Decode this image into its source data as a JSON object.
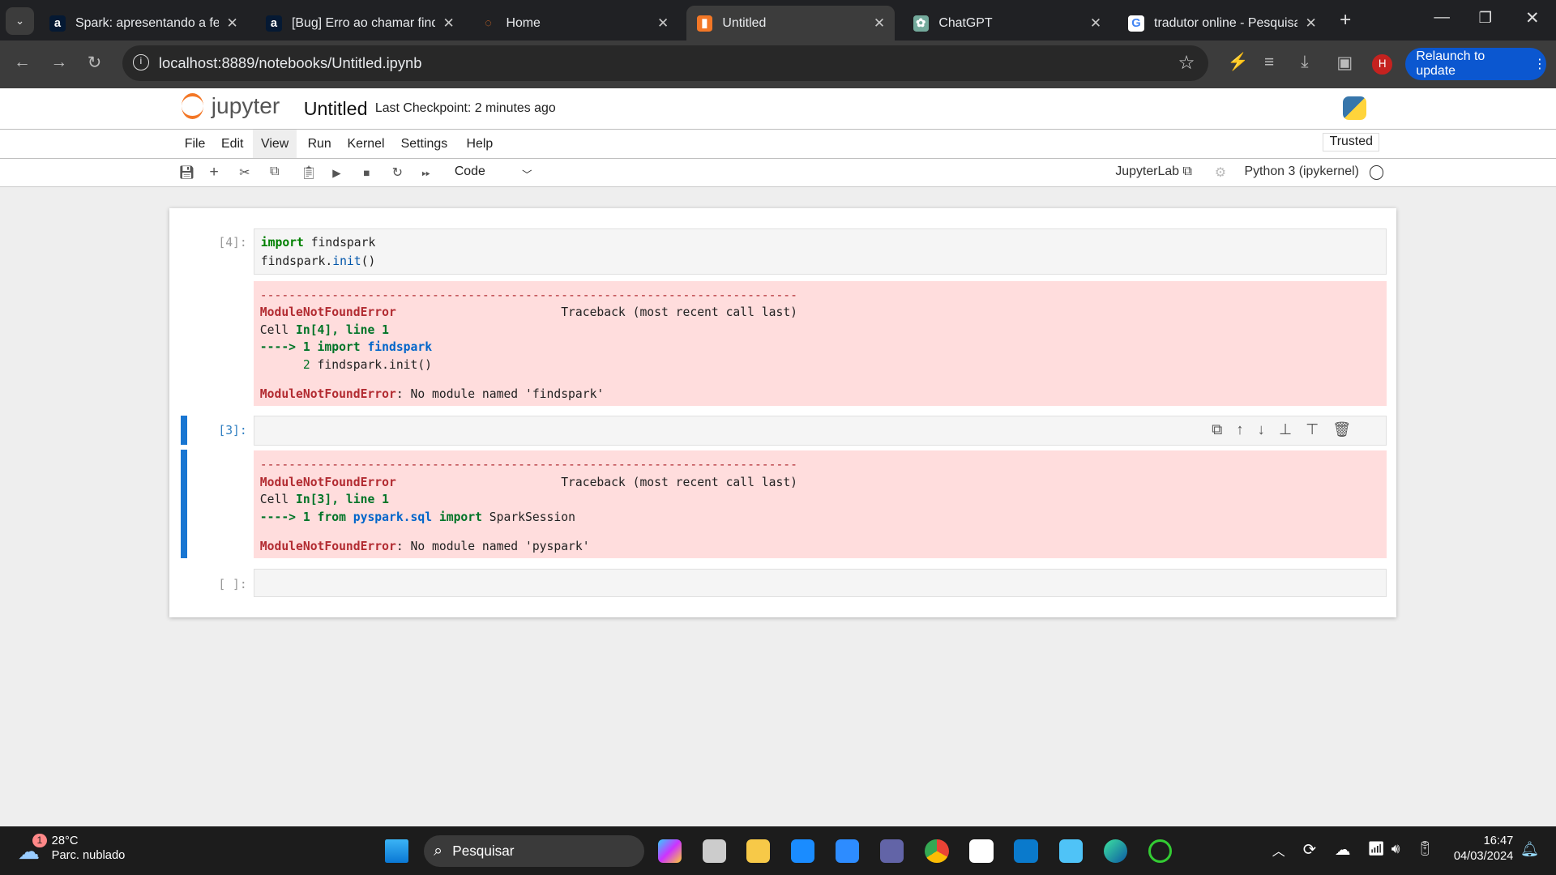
{
  "browser": {
    "tabs": [
      {
        "title": "Spark: apresentando a ferra",
        "icon": "alura-icon",
        "color": "#051933",
        "glyph": "a"
      },
      {
        "title": "[Bug] Erro ao chamar findsp",
        "icon": "alura-icon",
        "color": "#051933",
        "glyph": "a"
      },
      {
        "title": "Home",
        "icon": "jupyter-icon",
        "color": "transparent",
        "glyph": "◌"
      },
      {
        "title": "Untitled",
        "icon": "jupyter-notebook-icon",
        "color": "#f37726",
        "glyph": "▮",
        "active": true
      },
      {
        "title": "ChatGPT",
        "icon": "chatgpt-icon",
        "color": "#74aa9c",
        "glyph": "✿"
      },
      {
        "title": "tradutor online - Pesquisa",
        "icon": "google-icon",
        "color": "#fff",
        "glyph": "G"
      }
    ],
    "url": "localhost:8889/notebooks/Untitled.ipynb",
    "relaunch_label": "Relaunch to update",
    "profile_initial": "H"
  },
  "jupyter": {
    "logo_text": "jupyter",
    "notebook_title": "Untitled",
    "checkpoint": "Last Checkpoint: 2 minutes ago",
    "trusted": "Trusted",
    "menu": [
      "File",
      "Edit",
      "View",
      "Run",
      "Kernel",
      "Settings",
      "Help"
    ],
    "cell_type": "Code",
    "jupyterlab_link": "JupyterLab",
    "kernel": "Python 3 (ipykernel)"
  },
  "cells": [
    {
      "prompt": "[4]:",
      "code": [
        [
          [
            "import",
            "kw"
          ],
          [
            " findspark",
            ""
          ]
        ],
        [
          [
            "findspark.",
            ""
          ],
          [
            "init",
            "fn"
          ],
          [
            "()",
            ""
          ]
        ]
      ],
      "output": [
        [
          [
            "---------------------------------------------------------------------------",
            "c-red"
          ]
        ],
        [
          [
            "ModuleNotFoundError",
            "c-redb"
          ],
          [
            "                       Traceback (most recent call last)",
            ""
          ]
        ],
        [
          [
            "Cell ",
            ""
          ],
          [
            "In[4], line 1",
            "c-greenb"
          ]
        ],
        [
          [
            "----> 1 ",
            "c-greenb"
          ],
          [
            "import ",
            "c-greenb"
          ],
          [
            "findspark",
            "c-blueb"
          ]
        ],
        [
          [
            "      2 ",
            "c-green"
          ],
          [
            "findspark.init()",
            ""
          ]
        ],
        [
          [
            "",
            ""
          ]
        ],
        [
          [
            "ModuleNotFoundError",
            "c-redb"
          ],
          [
            ": No module named 'findspark'",
            ""
          ]
        ]
      ]
    },
    {
      "prompt": "[3]:",
      "code": [
        [
          [
            "from",
            "kw"
          ],
          [
            " pyspark.sql ",
            ""
          ],
          [
            "import",
            "kw"
          ],
          [
            " SparkSession",
            ""
          ]
        ]
      ],
      "output": [
        [
          [
            "---------------------------------------------------------------------------",
            "c-red"
          ]
        ],
        [
          [
            "ModuleNotFoundError",
            "c-redb"
          ],
          [
            "                       Traceback (most recent call last)",
            ""
          ]
        ],
        [
          [
            "Cell ",
            ""
          ],
          [
            "In[3], line 1",
            "c-greenb"
          ]
        ],
        [
          [
            "----> 1 ",
            "c-greenb"
          ],
          [
            "from ",
            "c-greenb"
          ],
          [
            "pyspark.sql",
            "c-blueb"
          ],
          [
            " import ",
            "c-greenb"
          ],
          [
            "SparkSession",
            ""
          ]
        ],
        [
          [
            "",
            ""
          ]
        ],
        [
          [
            "ModuleNotFoundError",
            "c-redb"
          ],
          [
            ": No module named 'pyspark'",
            ""
          ]
        ]
      ]
    },
    {
      "prompt": "[ ]:"
    }
  ],
  "taskbar": {
    "weather_temp": "28°C",
    "weather_desc": "Parc. nublado",
    "weather_badge": "1",
    "search_placeholder": "Pesquisar",
    "time": "16:47",
    "date": "04/03/2024"
  }
}
